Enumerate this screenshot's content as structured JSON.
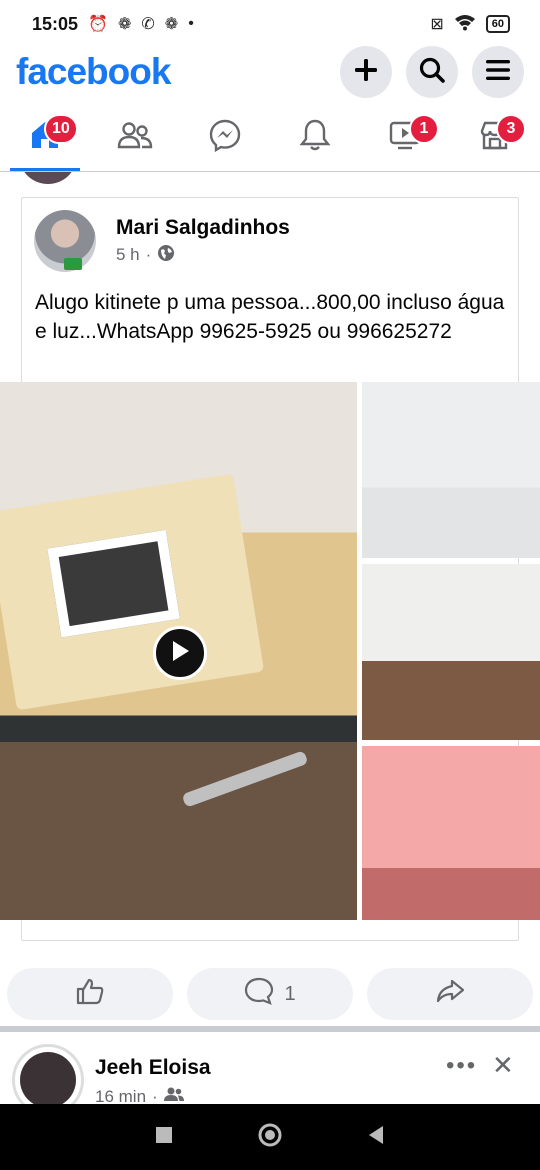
{
  "status_bar": {
    "time": "15:05",
    "battery": "60"
  },
  "header": {
    "logo": "facebook",
    "buttons": [
      "plus-icon",
      "search-icon",
      "menu-icon"
    ]
  },
  "tabs": [
    {
      "icon": "home-icon",
      "badge": "10",
      "active": true
    },
    {
      "icon": "friends-icon",
      "badge": ""
    },
    {
      "icon": "messenger-icon",
      "badge": ""
    },
    {
      "icon": "bell-icon",
      "badge": ""
    },
    {
      "icon": "video-icon",
      "badge": "1"
    },
    {
      "icon": "marketplace-icon",
      "badge": "3"
    }
  ],
  "post": {
    "author": "Mari Salgadinhos",
    "time": "5 h",
    "separator": "·",
    "text": "Alugo kitinete p uma pessoa...800,00 incluso água  e luz...WhatsApp 99625-5925 ou 996625272"
  },
  "actions": {
    "comment_count": "1"
  },
  "next_post": {
    "author": "Jeeh Eloisa",
    "time": "16 min",
    "separator": "·",
    "more": "•••",
    "close": "✕"
  },
  "colors": {
    "brand": "#1877f2",
    "badge": "#e41e3f"
  }
}
